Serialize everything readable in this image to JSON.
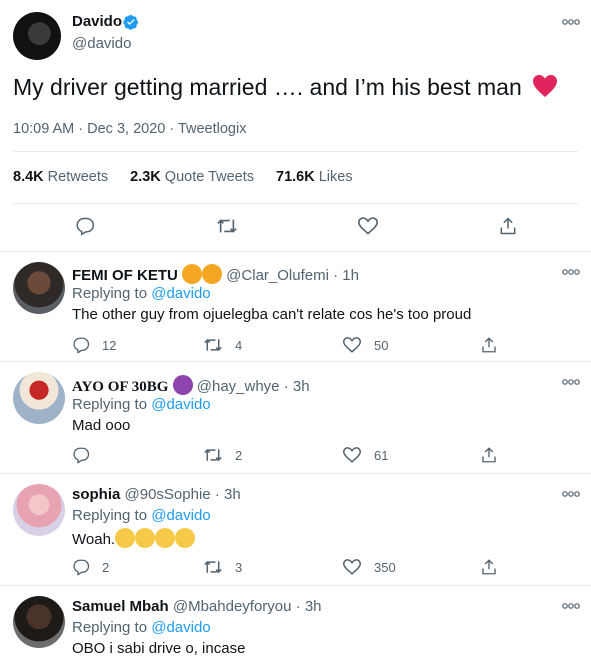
{
  "tweet": {
    "author_name": "Davido",
    "author_handle": "@davido",
    "text": "My driver getting married …. and I’m his best man",
    "meta": "10:09 AM · Dec 3, 2020 · Tweetlogix",
    "stats": {
      "retweets_count": "8.4K",
      "retweets_label": "Retweets",
      "quotes_count": "2.3K",
      "quotes_label": "Quote Tweets",
      "likes_count": "71.6K",
      "likes_label": "Likes"
    }
  },
  "replies": [
    {
      "name": "FEMI OF KETU",
      "handle": "@Clar_Olufemi",
      "time": "· 1h",
      "replying_prefix": "Replying to",
      "replying_to": "@davido",
      "text": "The other guy from ojuelegba can't relate cos he's too proud",
      "replies": "12",
      "retweets": "4",
      "likes": "50"
    },
    {
      "name": "AYO OF 30BG",
      "handle": "@hay_whye",
      "time": "· 3h",
      "replying_prefix": "Replying to",
      "replying_to": "@davido",
      "text": "Mad ooo",
      "replies": "",
      "retweets": "2",
      "likes": "61"
    },
    {
      "name": "sophia",
      "handle": "@90sSophie",
      "time": "· 3h",
      "replying_prefix": "Replying to",
      "replying_to": "@davido",
      "text": "Woah.",
      "replies": "2",
      "retweets": "3",
      "likes": "350"
    },
    {
      "name": "Samuel Mbah",
      "handle": "@Mbahdeyforyou",
      "time": "· 3h",
      "replying_prefix": "Replying to",
      "replying_to": "@davido",
      "text": "OBO i sabi drive o, incase"
    }
  ],
  "colors": {
    "accent": "#1d9bf0",
    "heart": "#e0245e",
    "text": "#0f1419",
    "secondary": "#536471"
  },
  "icons": [
    "verified-badge-icon",
    "more-icon",
    "reply-icon",
    "retweet-icon",
    "like-icon",
    "share-icon",
    "heart-emoji-icon",
    "lion-emoji-icon",
    "devil-emoji-icon",
    "clap-emoji-icon"
  ]
}
